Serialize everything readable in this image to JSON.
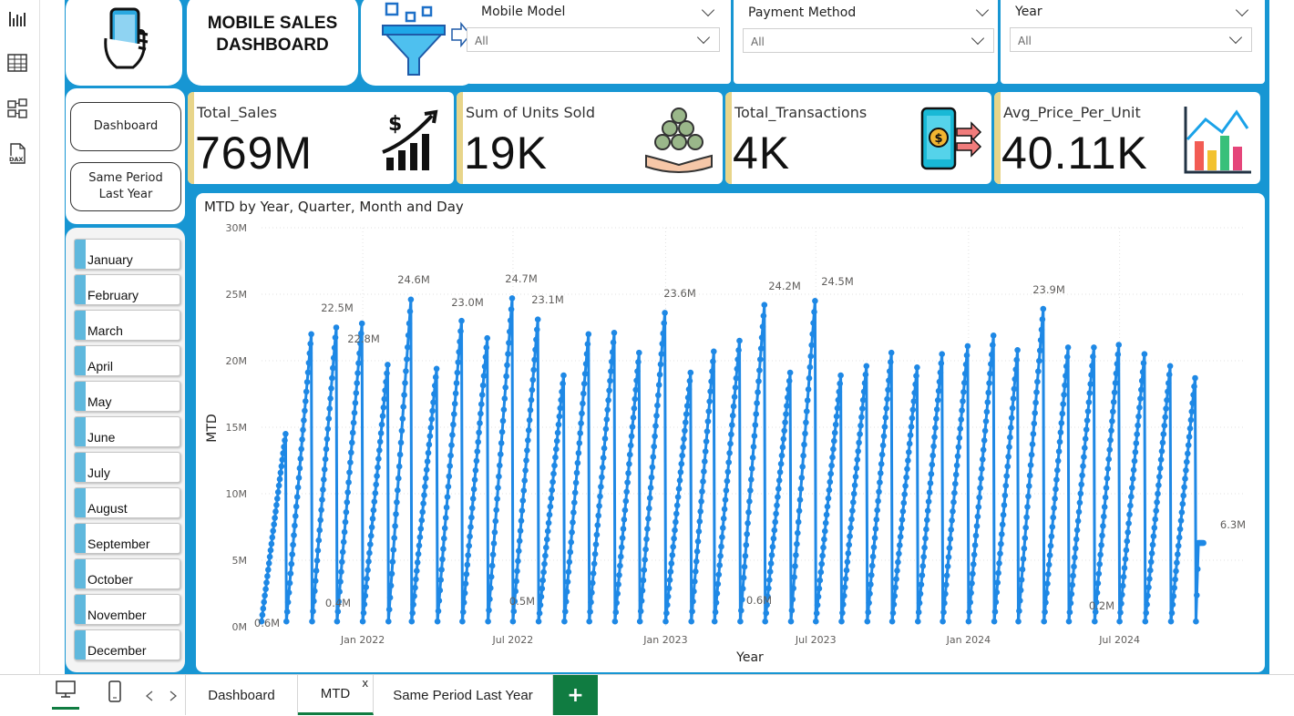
{
  "header": {
    "title_line1": "MOBILE SALES",
    "title_line2": "DASHBOARD"
  },
  "slicers": [
    {
      "title": "Mobile Model",
      "value": "All"
    },
    {
      "title": "Payment Method",
      "value": "All"
    },
    {
      "title": "Year",
      "value": "All"
    }
  ],
  "kpis": [
    {
      "label": "Total_Sales",
      "value": "769M"
    },
    {
      "label": "Sum of Units Sold",
      "value": "19K"
    },
    {
      "label": "Total_Transactions",
      "value": "4K"
    },
    {
      "label": "Avg_Price_Per_Unit",
      "value": "40.11K"
    }
  ],
  "nav": {
    "dashboard_label": "Dashboard",
    "same_period_label": "Same Period Last Year"
  },
  "months": [
    "January",
    "February",
    "March",
    "April",
    "May",
    "June",
    "July",
    "August",
    "September",
    "October",
    "November",
    "December"
  ],
  "tabs": [
    {
      "label": "Dashboard"
    },
    {
      "label": "MTD",
      "close": "x"
    },
    {
      "label": "Same Period Last Year"
    }
  ],
  "add_tab_label": "+",
  "colors": {
    "canvas": "#1796d3",
    "series": "#1e88e5",
    "kpi_accent": "#e8d58a",
    "month_tick": "#5fb8dd",
    "tab_active": "#107c41"
  },
  "chart_data": {
    "type": "line",
    "title": "MTD by Year, Quarter, Month and Day",
    "xlabel": "Year",
    "ylabel": "MTD",
    "ylim": [
      0,
      30000000
    ],
    "yticks": [
      "0M",
      "5M",
      "10M",
      "15M",
      "20M",
      "25M",
      "30M"
    ],
    "xticks": [
      "Jan 2022",
      "Jul 2022",
      "Jan 2023",
      "Jul 2023",
      "Jan 2024",
      "Jul 2024"
    ],
    "grid": true,
    "x_range": [
      "2021-09-01",
      "2024-11-30"
    ],
    "series": [
      {
        "month_peaks_millions": [
          14.5,
          22.0,
          22.5,
          22.8,
          19.7,
          24.6,
          19.4,
          23.0,
          21.7,
          24.7,
          23.1,
          18.9,
          22.0,
          22.1,
          20.6,
          23.6,
          19.1,
          20.7,
          21.5,
          24.2,
          19.1,
          24.5,
          18.9,
          19.6,
          20.6,
          19.5,
          20.5,
          21.1,
          21.9,
          20.8,
          23.9,
          21.0,
          21.0,
          21.2,
          20.5,
          19.6,
          18.7,
          6.3
        ],
        "month_min_millions": 0.4
      }
    ],
    "data_labels": [
      "0.6M",
      "22.5M",
      "22.8M",
      "0.4M",
      "24.6M",
      "23.0M",
      "24.7M",
      "23.1M",
      "0.5M",
      "23.6M",
      "0.6M",
      "24.2M",
      "24.5M",
      "23.9M",
      "0.2M",
      "6.3M"
    ]
  }
}
